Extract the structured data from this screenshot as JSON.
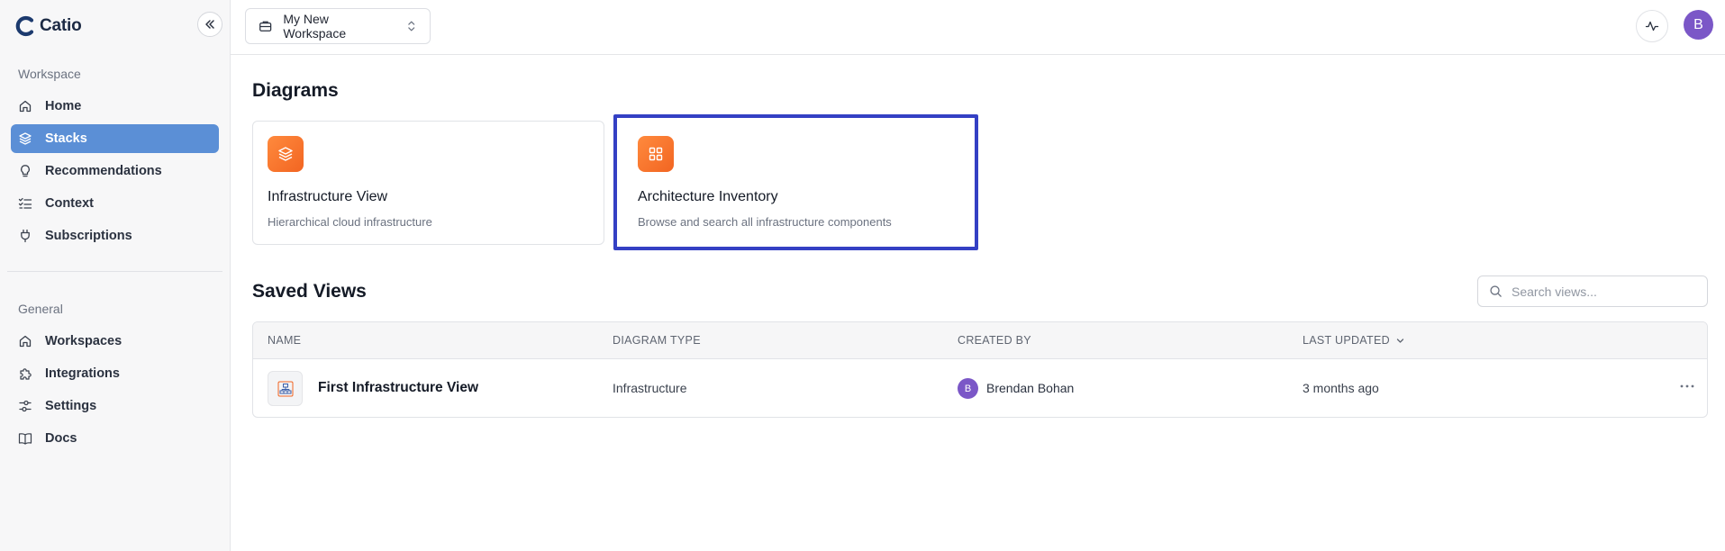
{
  "app": {
    "name": "Catio"
  },
  "sidebar": {
    "workspace_label": "Workspace",
    "workspace_items": [
      {
        "label": "Home",
        "icon": "home-icon"
      },
      {
        "label": "Stacks",
        "icon": "layers-icon",
        "active": true
      },
      {
        "label": "Recommendations",
        "icon": "lightbulb-icon"
      },
      {
        "label": "Context",
        "icon": "list-check-icon"
      },
      {
        "label": "Subscriptions",
        "icon": "plug-icon"
      }
    ],
    "general_label": "General",
    "general_items": [
      {
        "label": "Workspaces",
        "icon": "home-icon"
      },
      {
        "label": "Integrations",
        "icon": "puzzle-icon"
      },
      {
        "label": "Settings",
        "icon": "sliders-icon"
      },
      {
        "label": "Docs",
        "icon": "book-icon"
      }
    ]
  },
  "topbar": {
    "workspace_name": "My New Workspace",
    "avatar_initial": "B"
  },
  "diagrams": {
    "title": "Diagrams",
    "cards": [
      {
        "title": "Infrastructure View",
        "description": "Hierarchical cloud infrastructure",
        "icon": "layers-icon"
      },
      {
        "title": "Architecture Inventory",
        "description": "Browse and search all infrastructure components",
        "icon": "grid-icon"
      }
    ]
  },
  "saved_views": {
    "title": "Saved Views",
    "search_placeholder": "Search views...",
    "columns": [
      "NAME",
      "DIAGRAM TYPE",
      "CREATED BY",
      "LAST UPDATED"
    ],
    "sorted_column": "LAST UPDATED",
    "rows": [
      {
        "name": "First Infrastructure View",
        "diagram_type": "Infrastructure",
        "creator_initial": "B",
        "created_by": "Brendan Bohan",
        "last_updated": "3 months ago"
      }
    ]
  },
  "colors": {
    "accent": "#5b8fd6",
    "brand_orange": "#f26522",
    "avatar": "#7b57c7",
    "highlight_border": "#3440c4"
  }
}
